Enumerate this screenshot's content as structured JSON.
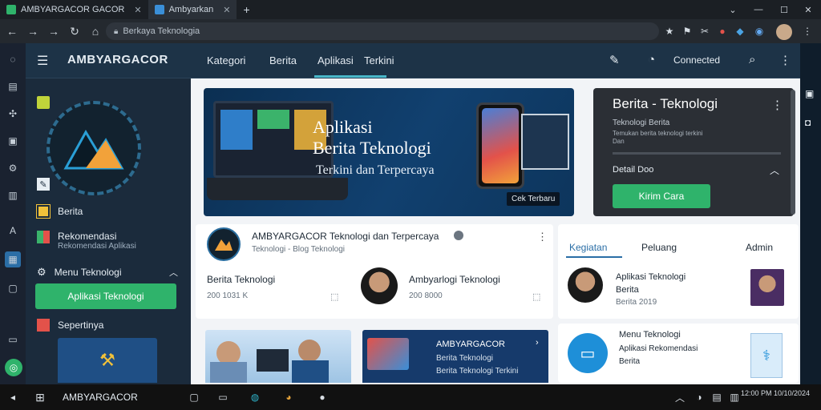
{
  "browser": {
    "tabs": [
      {
        "label": "AMBYARGACOR GACOR"
      },
      {
        "label": "Ambyarkan"
      }
    ],
    "address": "Berkaya Teknologia"
  },
  "site": {
    "logo_text": "AMBYARGACOR",
    "nav": [
      "Kategori",
      "Berita",
      "Aplikasi",
      "Terkini"
    ],
    "header_right_label": "Connected"
  },
  "sidebar": {
    "items": [
      {
        "label": "Berita"
      },
      {
        "label": "Rekomendasi",
        "sub": "Rekomendasi Aplikasi"
      },
      {
        "label": "Menu Teknologi"
      }
    ],
    "cta": "Aplikasi Teknologi",
    "bottom_label": "Sepertinya"
  },
  "hero": {
    "title_line1": "Aplikasi",
    "title_line2": "Berita Teknologi",
    "title_line3": "Terkini dan Terpercaya",
    "badge": "Cek Terbaru"
  },
  "side_panel": {
    "title": "Berita - Teknologi",
    "line1": "Teknologi Berita",
    "line2": "Temukan berita teknologi terkini",
    "line3": "Dan",
    "detail_label": "Detail Doo",
    "button": "Kirim Cara"
  },
  "feed": {
    "header_title": "AMBYARGACOR Teknologi dan Terpercaya",
    "header_sub": "Teknologi - Blog Teknologi",
    "post1_title": "Berita Teknologi",
    "post1_meta": "200 1031 K",
    "post2_title": "Ambyarlogi Teknologi",
    "post2_meta": "200 8000",
    "card1_title": "AMBYARGACOR",
    "card1_line1": "Berita Teknologi",
    "card1_line2": "Berita Teknologi Terkini"
  },
  "right_panel": {
    "tabs": [
      "Kegiatan",
      "Peluang",
      "Admin"
    ],
    "item1_title": "Aplikasi Teknologi",
    "item1_sub": "Berita",
    "item1_meta": "Berita 2019",
    "item2_title": "Menu Teknologi",
    "item2_line1": "Aplikasi Rekomendasi",
    "item2_line2": "Berita"
  },
  "taskbar": {
    "label": "AMBYARGACOR",
    "clock": "12:00 PM 10/10/2024"
  },
  "colors": {
    "accent": "#2fb36b",
    "header": "#1d3347",
    "sidebar": "#1b2b3c",
    "hero_bg": "#0e3b63"
  }
}
